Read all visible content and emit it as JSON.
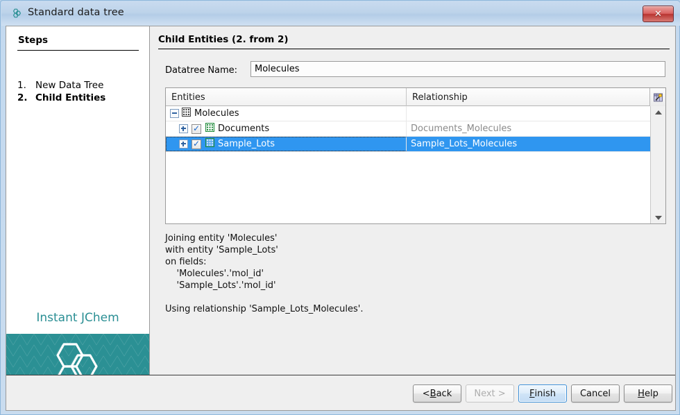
{
  "window": {
    "title": "Standard data tree",
    "title_icon": "jchem-hexagon-icon",
    "close_label": "✕"
  },
  "sidebar": {
    "heading": "Steps",
    "steps": [
      {
        "num": "1.",
        "label": "New Data Tree",
        "active": false
      },
      {
        "num": "2.",
        "label": "Child Entities",
        "active": true
      }
    ],
    "brand": "Instant JChem",
    "brand_color": "#2b9094"
  },
  "main": {
    "pane_title": "Child Entities (2. from 2)",
    "datatree": {
      "label": "Datatree Name:",
      "value": "Molecules",
      "placeholder": ""
    },
    "table": {
      "columns": [
        "Entities",
        "Relationship"
      ],
      "corner_icon": "column-chooser-icon",
      "rows": [
        {
          "entity": "Molecules",
          "relationship": "",
          "indent": 0,
          "toggle": "minus",
          "checkbox": false,
          "selected": false
        },
        {
          "entity": "Documents",
          "relationship": "Documents_Molecules",
          "indent": 1,
          "toggle": "plus",
          "checkbox": true,
          "selected": false
        },
        {
          "entity": "Sample_Lots",
          "relationship": "Sample_Lots_Molecules",
          "indent": 1,
          "toggle": "plus",
          "checkbox": true,
          "selected": true
        }
      ],
      "selection_color": "#2f96f0"
    },
    "description": "Joining entity 'Molecules'\nwith entity 'Sample_Lots'\non fields:\n    'Molecules'.'mol_id'\n    'Sample_Lots'.'mol_id'",
    "description2": "Using relationship 'Sample_Lots_Molecules'."
  },
  "footer": {
    "buttons": [
      {
        "id": "back",
        "pre": "< ",
        "mnemonic": "B",
        "post": "ack",
        "state": "enabled"
      },
      {
        "id": "next",
        "pre": "",
        "mnemonic": "N",
        "post": "ext >",
        "state": "disabled"
      },
      {
        "id": "finish",
        "pre": "",
        "mnemonic": "F",
        "post": "inish",
        "state": "default"
      },
      {
        "id": "cancel",
        "pre": "",
        "mnemonic": "",
        "post": "Cancel",
        "state": "enabled"
      },
      {
        "id": "help",
        "pre": "",
        "mnemonic": "H",
        "post": "elp",
        "state": "enabled"
      }
    ]
  }
}
